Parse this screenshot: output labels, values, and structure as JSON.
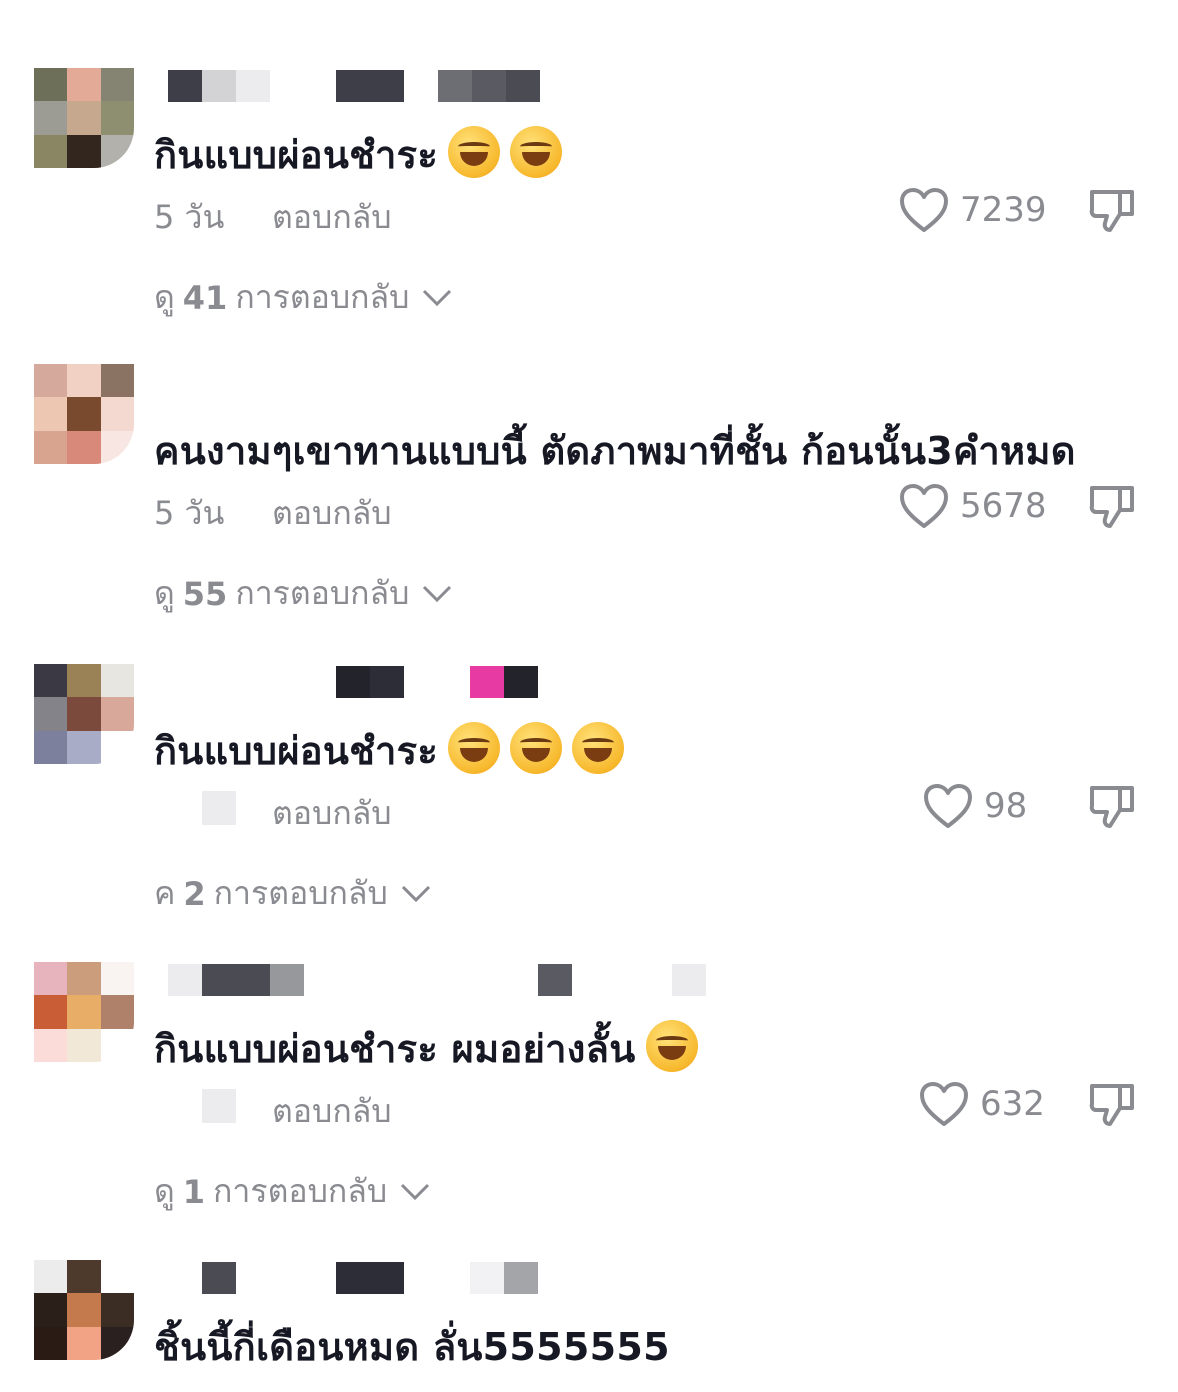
{
  "comments": [
    {
      "text": "กินแบบผ่อนชำระ",
      "emoji_count": 2,
      "age": "5 วัน",
      "reply_label": "ตอบกลับ",
      "likes": "7239",
      "view_prefix": "ดู",
      "reply_count": "41",
      "view_suffix": "การตอบกลับ",
      "avatar_colors": [
        "#6d6f58",
        "#e3aa98",
        "#858472",
        "#9c9c94",
        "#c6a88e",
        "#8d8f70",
        "#8a8663",
        "#33261f",
        "#b2b1ab"
      ]
    },
    {
      "text": "คนงามๆเขาทานแบบนี้ ตัดภาพมาที่ชั้น ก้อนนั้น3คำหมด",
      "emoji_count": 0,
      "age": "5 วัน",
      "reply_label": "ตอบกลับ",
      "likes": "5678",
      "view_prefix": "ดู",
      "reply_count": "55",
      "view_suffix": "การตอบกลับ",
      "avatar_colors": [
        "#d5a99c",
        "#f1d1c3",
        "#8b7363",
        "#eec7b3",
        "#7a4a2e",
        "#f3d9cf",
        "#d9a48f",
        "#d8897a",
        "#f7e6e1"
      ]
    },
    {
      "text": "กินแบบผ่อนชำระ",
      "emoji_count": 3,
      "age": "",
      "reply_label": "ตอบกลับ",
      "likes": "98",
      "view_prefix": "ค",
      "reply_count": "2",
      "view_suffix": "การตอบกลับ",
      "avatar_colors": [
        "#3a3944",
        "#9b8256",
        "#e8e6e1",
        "#84838a",
        "#7c4a3c",
        "#d8a89a",
        "#7c809c",
        "#a9acc6",
        "#ffffff"
      ]
    },
    {
      "text": "กินแบบผ่อนชำระ ผมอย่างลั้น",
      "emoji_count": 1,
      "age": "",
      "reply_label": "ตอบกลับ",
      "likes": "632",
      "view_prefix": "ดู",
      "reply_count": "1",
      "view_suffix": "การตอบกลับ",
      "avatar_colors": [
        "#e7b3bd",
        "#cb9d7c",
        "#f9f4f1",
        "#c95e36",
        "#e8ad67",
        "#b0816a",
        "#fbdcd8",
        "#f1e8d7",
        "#ffffff"
      ]
    },
    {
      "text": "ชิ้นนี้กี่เดือนหมด ลั่น5555555",
      "emoji_count": 0,
      "avatar_colors": [
        "#ececec",
        "#4d3a2c",
        "#ffffff",
        "#2a1f19",
        "#c47a4c",
        "#3b2d24",
        "#2b1b15",
        "#f2a285",
        "#2b2020"
      ]
    }
  ]
}
